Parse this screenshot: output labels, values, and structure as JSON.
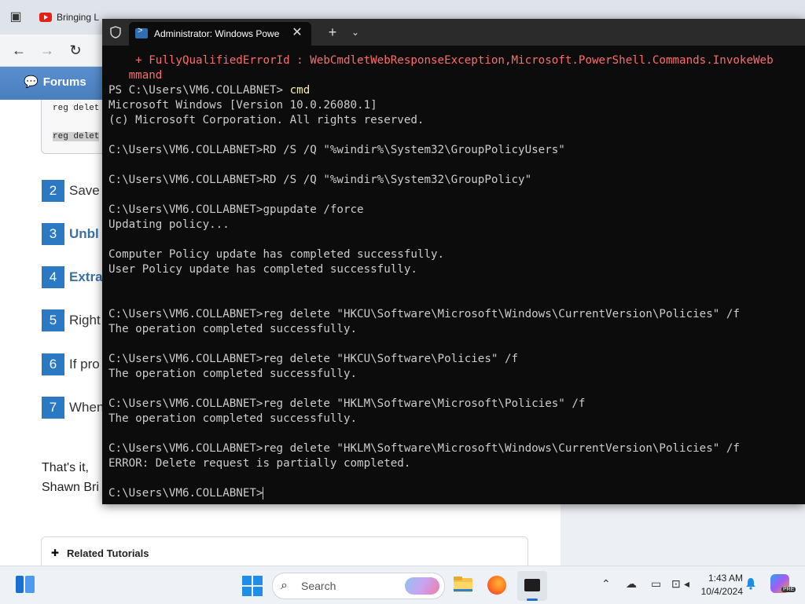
{
  "browser": {
    "tab_title": "Bringing L",
    "nav": {
      "forums_label": "Forums"
    },
    "code_lines": [
      "reg delet",
      "reg delet"
    ],
    "steps": [
      {
        "num": "2",
        "text": "Save",
        "bold": false
      },
      {
        "num": "3",
        "text": "Unbl",
        "bold": true
      },
      {
        "num": "4",
        "text": "Extra",
        "bold": true
      },
      {
        "num": "5",
        "text": "Right",
        "bold": false
      },
      {
        "num": "6",
        "text": "If pro",
        "bold": false
      },
      {
        "num": "7",
        "text": "When",
        "bold": false
      }
    ],
    "closing_line_1": "That's it,",
    "closing_line_2": "Shawn Bri",
    "related_title": "Related Tutorials"
  },
  "terminal": {
    "tab_title": "Administrator: Windows Powe",
    "lines": [
      {
        "text": "    + FullyQualifiedErrorId : WebCmdletWebResponseException,Microsoft.PowerShell.Commands.InvokeWeb",
        "style": "err"
      },
      {
        "text": "   mmand",
        "style": "err"
      },
      {
        "text": "PS C:\\Users\\VM6.COLLABNET> ",
        "style": "",
        "extra": "cmd",
        "extra_style": "cmd-yellow"
      },
      {
        "text": "Microsoft Windows [Version 10.0.26080.1]",
        "style": ""
      },
      {
        "text": "(c) Microsoft Corporation. All rights reserved.",
        "style": ""
      },
      {
        "text": "",
        "style": ""
      },
      {
        "text": "C:\\Users\\VM6.COLLABNET>RD /S /Q \"%windir%\\System32\\GroupPolicyUsers\"",
        "style": ""
      },
      {
        "text": "",
        "style": ""
      },
      {
        "text": "C:\\Users\\VM6.COLLABNET>RD /S /Q \"%windir%\\System32\\GroupPolicy\"",
        "style": ""
      },
      {
        "text": "",
        "style": ""
      },
      {
        "text": "C:\\Users\\VM6.COLLABNET>gpupdate /force",
        "style": ""
      },
      {
        "text": "Updating policy...",
        "style": ""
      },
      {
        "text": "",
        "style": ""
      },
      {
        "text": "Computer Policy update has completed successfully.",
        "style": ""
      },
      {
        "text": "User Policy update has completed successfully.",
        "style": ""
      },
      {
        "text": "",
        "style": ""
      },
      {
        "text": "",
        "style": ""
      },
      {
        "text": "C:\\Users\\VM6.COLLABNET>reg delete \"HKCU\\Software\\Microsoft\\Windows\\CurrentVersion\\Policies\" /f",
        "style": ""
      },
      {
        "text": "The operation completed successfully.",
        "style": ""
      },
      {
        "text": "",
        "style": ""
      },
      {
        "text": "C:\\Users\\VM6.COLLABNET>reg delete \"HKCU\\Software\\Policies\" /f",
        "style": ""
      },
      {
        "text": "The operation completed successfully.",
        "style": ""
      },
      {
        "text": "",
        "style": ""
      },
      {
        "text": "C:\\Users\\VM6.COLLABNET>reg delete \"HKLM\\Software\\Microsoft\\Policies\" /f",
        "style": ""
      },
      {
        "text": "The operation completed successfully.",
        "style": ""
      },
      {
        "text": "",
        "style": ""
      },
      {
        "text": "C:\\Users\\VM6.COLLABNET>reg delete \"HKLM\\Software\\Microsoft\\Windows\\CurrentVersion\\Policies\" /f",
        "style": ""
      },
      {
        "text": "ERROR: Delete request is partially completed.",
        "style": ""
      },
      {
        "text": "",
        "style": ""
      },
      {
        "text": "C:\\Users\\VM6.COLLABNET>",
        "style": "",
        "cursor": true
      }
    ]
  },
  "taskbar": {
    "search_label": "Search",
    "clock_time": "1:43 AM",
    "clock_date": "10/4/2024",
    "copilot_badge": "PRE"
  }
}
